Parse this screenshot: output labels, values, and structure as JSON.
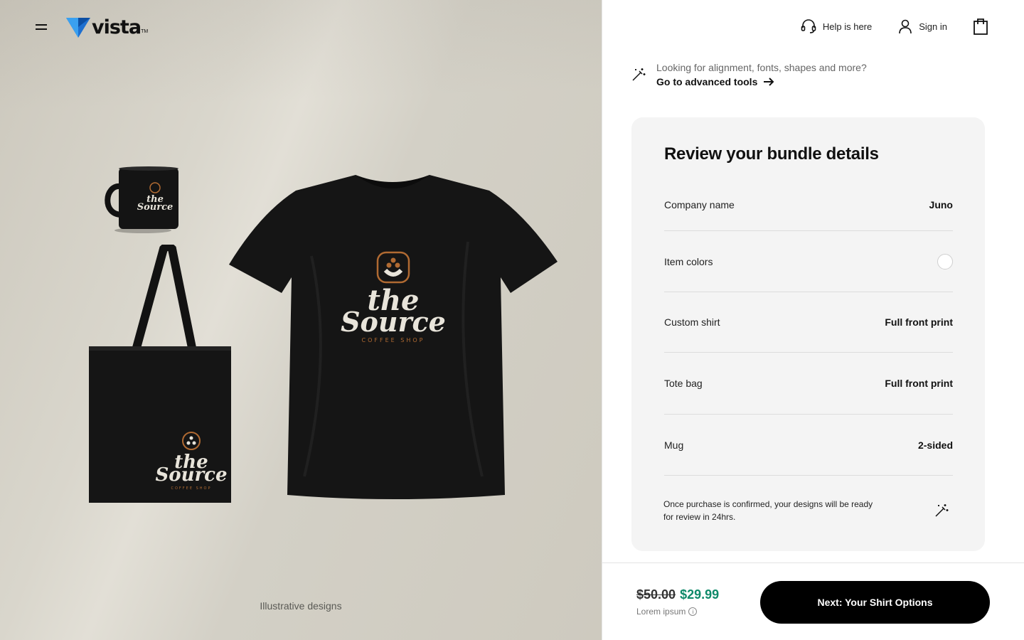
{
  "header": {
    "brand": "vista",
    "trademark": "TM",
    "help_label": "Help is here",
    "signin_label": "Sign in"
  },
  "hero": {
    "caption": "Illustrative designs",
    "print_brand_line1": "the",
    "print_brand_line2": "Source",
    "print_tagline": "COFFEE SHOP"
  },
  "advanced": {
    "hint": "Looking for alignment, fonts, shapes and more?",
    "link": "Go to advanced tools"
  },
  "bundle": {
    "title": "Review your bundle details",
    "rows": [
      {
        "label": "Company name",
        "value": "Juno"
      },
      {
        "label": "Item colors",
        "value": ""
      },
      {
        "label": "Custom shirt",
        "value": "Full front print"
      },
      {
        "label": "Tote bag",
        "value": "Full front print"
      },
      {
        "label": "Mug",
        "value": "2-sided"
      }
    ],
    "note": "Once purchase is confirmed, your designs will be ready for review in 24hrs."
  },
  "checkout": {
    "old_price": "$50.00",
    "new_price": "$29.99",
    "sub_label": "Lorem ipsum",
    "cta": "Next: Your Shirt Options"
  },
  "colors": {
    "accent_price": "#0f8a6a",
    "cta_bg": "#000000",
    "logo_blue": "#1e6fd0",
    "print_copper": "#b06a32"
  },
  "icons": [
    "menu-icon",
    "vista-logo-icon",
    "headset-icon",
    "user-icon",
    "bag-icon",
    "magic-wand-icon",
    "arrow-right-icon",
    "info-icon"
  ]
}
